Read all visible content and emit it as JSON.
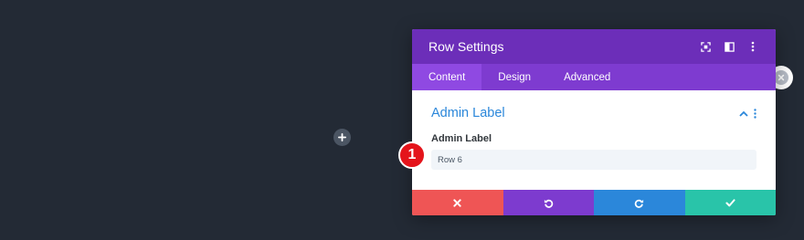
{
  "canvas": {
    "add_icon": "plus-icon"
  },
  "modal": {
    "title": "Row Settings",
    "header_icons": [
      "fullscreen-icon",
      "split-view-icon",
      "more-vertical-icon"
    ],
    "tabs": [
      {
        "label": "Content",
        "active": true
      },
      {
        "label": "Design",
        "active": false
      },
      {
        "label": "Advanced",
        "active": false
      }
    ],
    "section": {
      "title": "Admin Label",
      "field_label": "Admin Label",
      "field_value": "Row 6"
    },
    "footer": {
      "cancel_icon": "close-icon",
      "undo_icon": "undo-icon",
      "redo_icon": "redo-icon",
      "save_icon": "check-icon"
    }
  },
  "annotation": {
    "step_number": "1"
  },
  "colors": {
    "background": "#232a35",
    "header": "#6c2eb9",
    "tabs": "#7e3bd0",
    "accent_blue": "#2b87da",
    "cancel": "#ef5555",
    "save": "#29c4a9",
    "badge": "#e4141b"
  }
}
